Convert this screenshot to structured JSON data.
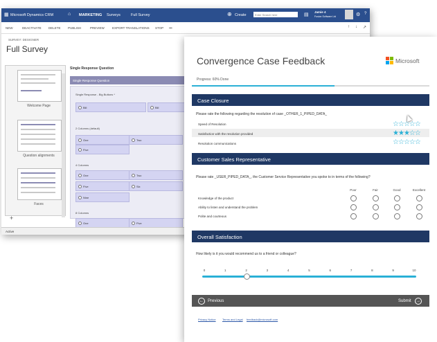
{
  "crm": {
    "nav": {
      "app_title": "Microsoft Dynamics CRM",
      "area": "MARKETING",
      "surveys": "Surveys",
      "record": "Full Survey",
      "create": "Create",
      "search_placeholder": "Enter Search here",
      "user_name": "Jamie 4",
      "user_org": "Fusion Software Ltd"
    },
    "toolbar": {
      "new": "NEW",
      "deactivate": "DEACTIVATE",
      "delete": "DELETE",
      "publish": "PUBLISH",
      "preview": "PREVIEW",
      "export": "EXPORT TRANSLATIONS",
      "stop": "STOP",
      "more": "•••"
    },
    "form_label": "SURVEY: DESIGNER",
    "title": "Full Survey",
    "pages": [
      "Welcome Page",
      "Question alignments",
      "Faces"
    ],
    "question_title": "Single Response Question",
    "question_header": "Single Response Question",
    "groups": [
      {
        "label": "Single Response - Big Buttons *",
        "options": [
          "Bill",
          "Bill"
        ]
      },
      {
        "label": "2 Columns (default)",
        "options": [
          "One",
          "Two",
          "Five"
        ]
      },
      {
        "label": "4 Columns",
        "options": [
          "One",
          "Two",
          "Five",
          "Six",
          "Nine"
        ]
      },
      {
        "label": "8 Columns",
        "options": [
          "One",
          "Five"
        ]
      }
    ],
    "status": "Active",
    "add_icon": "+"
  },
  "survey": {
    "title": "Convergence Case Feedback",
    "logo_text": "Microsoft",
    "progress_label": "Progress: 60% Done",
    "progress": 0.6,
    "sections": {
      "closure": "Case Closure",
      "rep": "Customer Sales Representative",
      "overall": "Overall Satisfaction"
    },
    "closure_prompt": "Please rate the following regarding the resolution of case _OTHER_1_PIPED_DATA_",
    "closure_rows": [
      {
        "label": "Speed of Resolution",
        "rating": 0
      },
      {
        "label": "Satisfaction with the resolution provided",
        "rating": 3
      },
      {
        "label": "Resolution communications",
        "rating": 0
      }
    ],
    "rep_prompt": "Please rate _USER_PIPED_DATA_, the Customer Service Representative you spoke to in terms of the following?",
    "rep_columns": [
      "Poor",
      "Fair",
      "Good",
      "Excellent"
    ],
    "rep_rows": [
      "Knowledge of the product",
      "Ability to listen and understand the problem",
      "Polite and courteous"
    ],
    "nps_prompt": "How likely is it you would recommend us to a friend or colleague?",
    "nps_ticks": [
      "0",
      "1",
      "2",
      "3",
      "4",
      "5",
      "6",
      "7",
      "8",
      "9",
      "10"
    ],
    "nps_value": 2,
    "previous": "Previous",
    "submit": "Submit",
    "footer_links": [
      "Privacy Notice",
      "Terms and Legal",
      "feedback@microsoft.com"
    ]
  },
  "colors": {
    "crm_nav": "#2b4f8e",
    "section_header": "#1f3864",
    "accent": "#2ab0d6",
    "star": "#2ab0d6",
    "nav_bar": "#555555"
  },
  "icons": [
    "grid-icon",
    "home-icon",
    "plus-circle-icon",
    "search-icon",
    "gear-icon",
    "help-icon",
    "star-icon",
    "chevron-left-icon",
    "chevron-right-icon"
  ]
}
